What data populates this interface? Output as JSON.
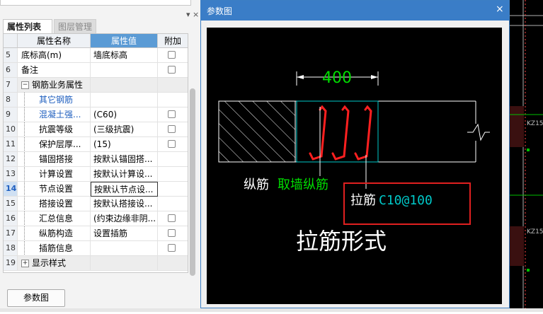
{
  "panel": {
    "pin_close": "▾ ×",
    "tabs": [
      "属性列表",
      "图层管理"
    ],
    "headers": {
      "name": "属性名称",
      "value": "属性值",
      "extra": "附加"
    },
    "rows": [
      {
        "num": "5",
        "name": "底标高(m)",
        "value": "墙底标高",
        "checkbox": true
      },
      {
        "num": "6",
        "name": "备注",
        "value": "",
        "checkbox": true
      },
      {
        "num": "7",
        "name": "钢筋业务属性",
        "value": "",
        "checkbox": false,
        "group": true,
        "expander": "−"
      },
      {
        "num": "8",
        "name": "其它钢筋",
        "value": "",
        "checkbox": false,
        "sub": true,
        "blue": true
      },
      {
        "num": "9",
        "name": "混凝土强...",
        "value": "(C60)",
        "checkbox": true,
        "sub": true,
        "blue": true
      },
      {
        "num": "10",
        "name": "抗震等级",
        "value": "(三级抗震)",
        "checkbox": true,
        "sub": true
      },
      {
        "num": "11",
        "name": "保护层厚...",
        "value": "(15)",
        "checkbox": true,
        "sub": true
      },
      {
        "num": "12",
        "name": "锚固搭接",
        "value": "按默认锚固搭...",
        "checkbox": false,
        "sub": true
      },
      {
        "num": "13",
        "name": "计算设置",
        "value": "按默认计算设...",
        "checkbox": false,
        "sub": true
      },
      {
        "num": "14",
        "name": "节点设置",
        "value": "按默认节点设...",
        "checkbox": false,
        "sub": true,
        "selected": true
      },
      {
        "num": "15",
        "name": "搭接设置",
        "value": "按默认搭接设...",
        "checkbox": false,
        "sub": true
      },
      {
        "num": "16",
        "name": "汇总信息",
        "value": "(约束边缘非阴...",
        "checkbox": true,
        "sub": true
      },
      {
        "num": "17",
        "name": "纵筋构造",
        "value": "设置插筋",
        "checkbox": true,
        "sub": true
      },
      {
        "num": "18",
        "name": "插筋信息",
        "value": "",
        "checkbox": true,
        "sub": true
      },
      {
        "num": "19",
        "name": "显示样式",
        "value": "",
        "checkbox": false,
        "group": true,
        "expander": "+"
      }
    ],
    "param_button": "参数图"
  },
  "dialog": {
    "title": "参数图",
    "close": "×",
    "drawing": {
      "dimension": "400",
      "label_longitudinal": "纵筋",
      "label_longitudinal_value": "取墙纵筋",
      "label_tie": "拉筋",
      "label_tie_value": "C10@100",
      "caption": "拉筋形式"
    }
  },
  "background": {
    "label_1": "KZ15",
    "label_2": "KZ15"
  },
  "colors": {
    "title_bar": "#3a7dc7",
    "header_selected": "#5b9bd5",
    "dim_green": "#00dd00",
    "rebar_red": "#ff2020",
    "highlight_box": "#e02020",
    "cyan": "#00c8c8"
  }
}
